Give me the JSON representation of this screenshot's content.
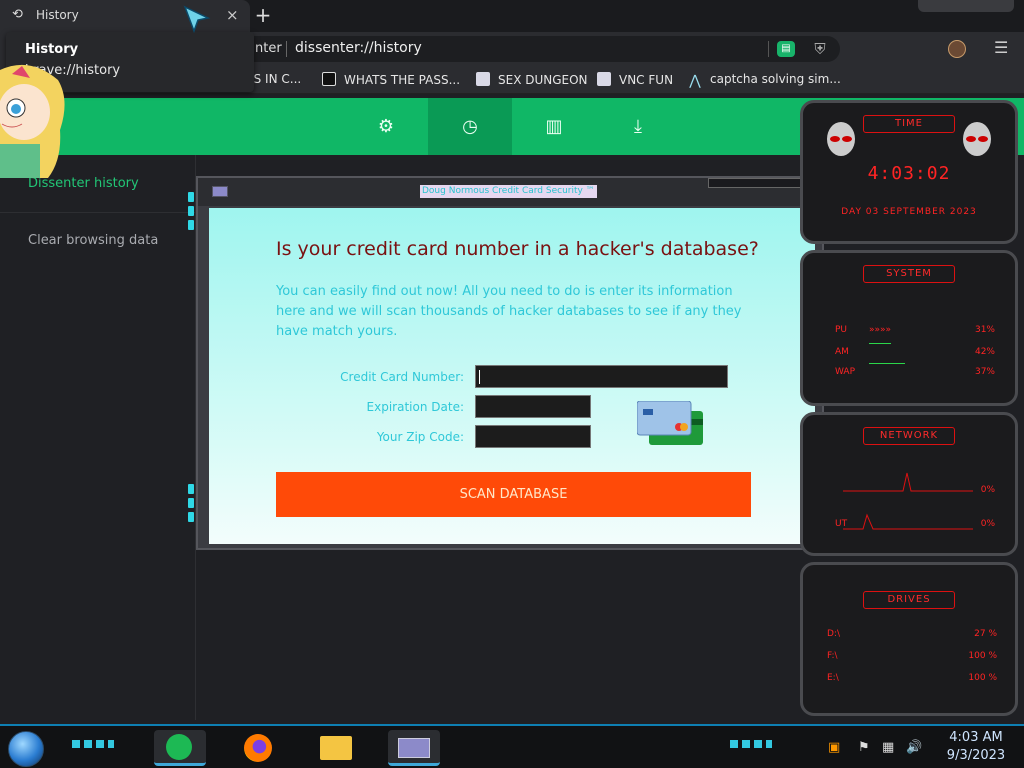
{
  "tab": {
    "title": "History",
    "close": "×",
    "new": "+"
  },
  "tooltip": {
    "title": "History",
    "url": "brave://history"
  },
  "omnibox": {
    "site": "nter",
    "url": "dissenter://history"
  },
  "bookmarks": [
    {
      "label": "SS IN C..."
    },
    {
      "label": "WHATS THE PASS..."
    },
    {
      "label": "SEX DUNGEON"
    },
    {
      "label": "VNC FUN"
    },
    {
      "label": "captcha solving sim..."
    }
  ],
  "nav_icons": [
    "settings-icon",
    "history-icon",
    "bookmarks-icon",
    "downloads-icon"
  ],
  "sidebar": {
    "active_item": "Dissenter history",
    "clear_item": "Clear browsing data"
  },
  "dialog": {
    "title": "Doug Normous Credit Card Security ™",
    "headline": "Is your credit card number in a hacker's database?",
    "paragraph": "You can easily find out now! All you need to do is enter its information here and we will scan thousands of hacker databases to see if any they have match yours.",
    "labels": {
      "card_number": "Credit Card Number:",
      "expiration": "Expiration Date:",
      "zip": "Your Zip Code:"
    },
    "button": "SCAN DATABASE"
  },
  "widgets": {
    "time": {
      "header": "TIME",
      "clock": "4:03:02",
      "date": "DAY 03 SEPTEMBER 2023"
    },
    "system": {
      "header": "SYSTEM",
      "rows": [
        {
          "label": "PU",
          "value": "31%"
        },
        {
          "label": "AM",
          "value": "42%"
        },
        {
          "label": "WAP",
          "value": "37%"
        }
      ]
    },
    "network": {
      "header": "NETWORK",
      "rows": [
        {
          "label": "",
          "value": "0%"
        },
        {
          "label": "UT",
          "value": "0%"
        }
      ]
    },
    "drives": {
      "header": "DRIVES",
      "rows": [
        {
          "label": "D:\\",
          "value": "27 %"
        },
        {
          "label": "F:\\",
          "value": "100 %"
        },
        {
          "label": "E:\\",
          "value": "100 %"
        }
      ]
    }
  },
  "taskbar": {
    "apps": [
      "sheets-app-icon",
      "firefox-icon",
      "file-explorer-icon",
      "credit-card-app-icon"
    ],
    "time": "4:03 AM",
    "date": "9/3/2023"
  }
}
